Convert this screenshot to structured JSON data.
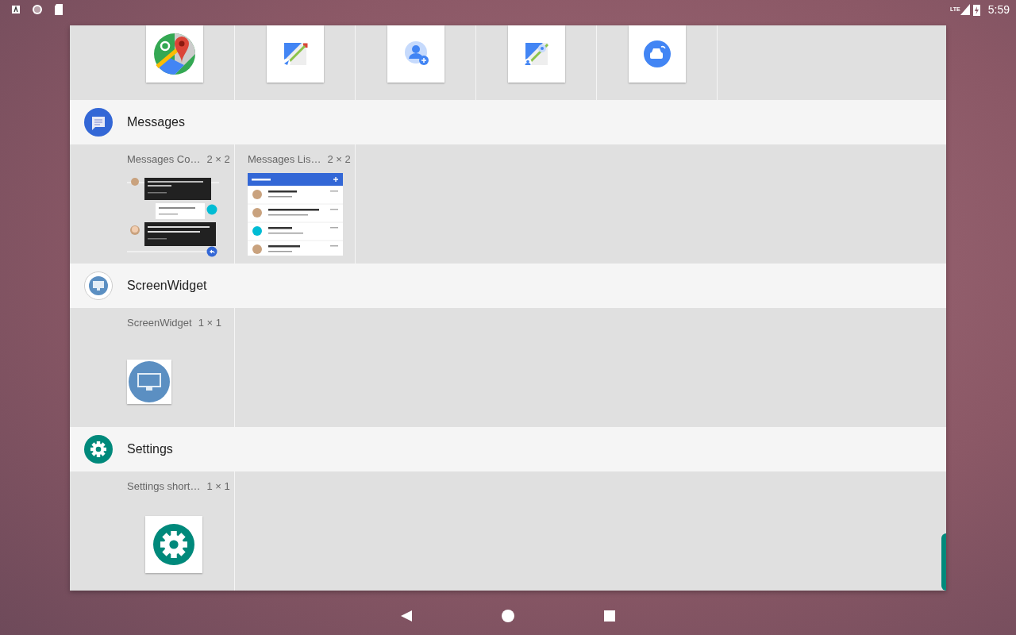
{
  "status_bar": {
    "time": "5:59",
    "network": "LTE"
  },
  "top_row": {
    "tiles": [
      {
        "kind": "maps"
      },
      {
        "kind": "navigation"
      },
      {
        "kind": "contact"
      },
      {
        "kind": "street"
      },
      {
        "kind": "car"
      }
    ]
  },
  "sections": [
    {
      "title": "Messages",
      "kind": "messages",
      "widgets": [
        {
          "name": "Messages Co…",
          "size": "2 × 2",
          "preview": {
            "kind": "conversation"
          }
        },
        {
          "name": "Messages Lis…",
          "size": "2 × 2",
          "preview": {
            "kind": "list"
          }
        }
      ]
    },
    {
      "title": "ScreenWidget",
      "kind": "monitor",
      "widgets": [
        {
          "name": "ScreenWidget",
          "size": "1 × 1",
          "preview": {
            "kind": "monitor"
          }
        }
      ]
    },
    {
      "title": "Settings",
      "kind": "gear",
      "widgets": [
        {
          "name": "Settings short…",
          "size": "1 × 1",
          "preview": {
            "kind": "gear"
          }
        }
      ]
    }
  ]
}
